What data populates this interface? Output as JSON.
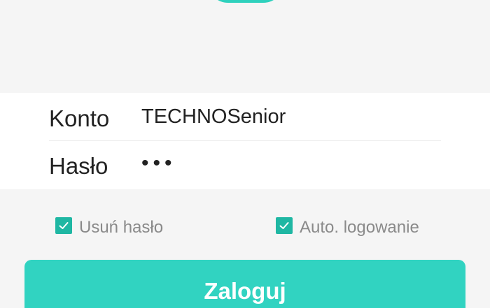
{
  "colors": {
    "background": "#f5f5f5",
    "accent": "#31d3c1",
    "checkbox": "#1fb7a3",
    "label_text": "#222222",
    "option_text": "#8a8a8a"
  },
  "form": {
    "account_label": "Konto",
    "account_value": "TECHNOSenior",
    "password_label": "Hasło",
    "password_value": "•••"
  },
  "options": {
    "remove_password": {
      "label": "Usuń hasło",
      "checked": true,
      "icon": "checkmark-icon"
    },
    "auto_login": {
      "label": "Auto. logowanie",
      "checked": true,
      "icon": "checkmark-icon"
    }
  },
  "login_button": {
    "label": "Zaloguj"
  }
}
